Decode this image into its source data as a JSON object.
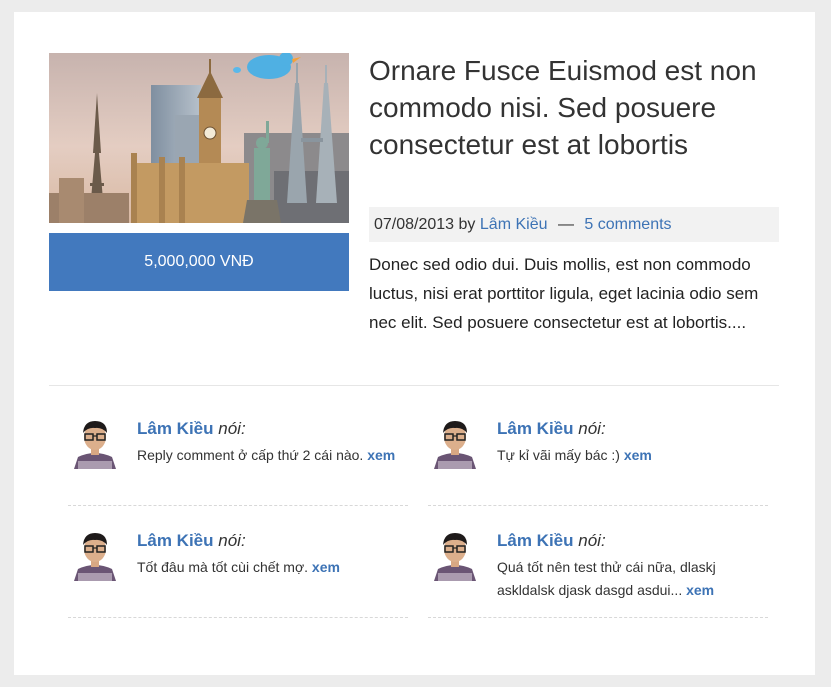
{
  "post": {
    "title": "Ornare Fusce Euismod est non commodo nisi. Sed posuere consectetur est at lobortis",
    "price": "5,000,000 VNĐ",
    "date": "07/08/2013",
    "by": "by",
    "author": "Lâm Kiều",
    "separator": "—",
    "comments_link": "5 comments",
    "excerpt": "Donec sed odio dui. Duis mollis, est non commodo luctus, nisi erat porttitor ligula, eget lacinia odio sem nec elit. Sed posuere consectetur est at lobortis....",
    "image_icon": "travel-landmarks-twitter-bird-image"
  },
  "comments": [
    {
      "author": "Lâm Kiều",
      "said": "nói:",
      "text": "Reply comment ở cấp thứ 2 cái nào.",
      "more": "xem"
    },
    {
      "author": "Lâm Kiều",
      "said": "nói:",
      "text": "Tự kỉ vãi mấy bác :)",
      "more": "xem"
    },
    {
      "author": "Lâm Kiều",
      "said": "nói:",
      "text": "Tốt đâu mà tốt cùi chết mợ.",
      "more": "xem"
    },
    {
      "author": "Lâm Kiều",
      "said": "nói:",
      "text": "Quá tốt nên test thử cái nữa, dlaskj askldalsk djask dasgd asdui...",
      "more": "xem"
    }
  ],
  "colors": {
    "accent": "#3d73b5",
    "price_bg": "#4279be",
    "meta_bg": "#f2f2f2"
  }
}
